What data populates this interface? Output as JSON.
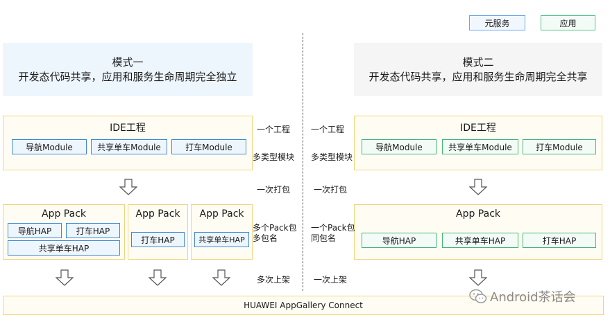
{
  "legend": {
    "atomic_service": "元服务",
    "application": "应用"
  },
  "mode1": {
    "title": "模式一",
    "description": "开发态代码共享，应用和服务生命周期完全独立",
    "ide": {
      "title": "IDE工程",
      "modules": [
        "导航Module",
        "共享单车Module",
        "打车Module"
      ]
    },
    "packs": [
      {
        "title": "App Pack",
        "haps": [
          "导航HAP",
          "打车HAP",
          "共享单车HAP"
        ]
      },
      {
        "title": "App Pack",
        "haps": [
          "打车HAP"
        ]
      },
      {
        "title": "App Pack",
        "haps": [
          "共享单车HAP"
        ]
      }
    ],
    "labels": {
      "one_project": "一个工程",
      "multi_module": "多类型模块",
      "one_build": "一次打包",
      "multi_pack_1": "多个Pack包",
      "multi_pack_2": "多包名",
      "multi_release": "多次上架"
    }
  },
  "mode2": {
    "title": "模式二",
    "description": "开发态代码共享，应用和服务生命周期完全共享",
    "ide": {
      "title": "IDE工程",
      "modules": [
        "导航Module",
        "共享单车Module",
        "打车Module"
      ]
    },
    "pack": {
      "title": "App Pack",
      "haps": [
        "导航HAP",
        "共享单车HAP",
        "打车HAP"
      ]
    },
    "labels": {
      "one_project": "一个工程",
      "multi_module": "多类型模块",
      "one_build": "一次打包",
      "one_pack_1": "一个Pack包",
      "one_pack_2": "同包名",
      "one_release": "一次上架"
    }
  },
  "gallery": "HUAWEI AppGallery Connect",
  "watermark": "Android茶话会"
}
